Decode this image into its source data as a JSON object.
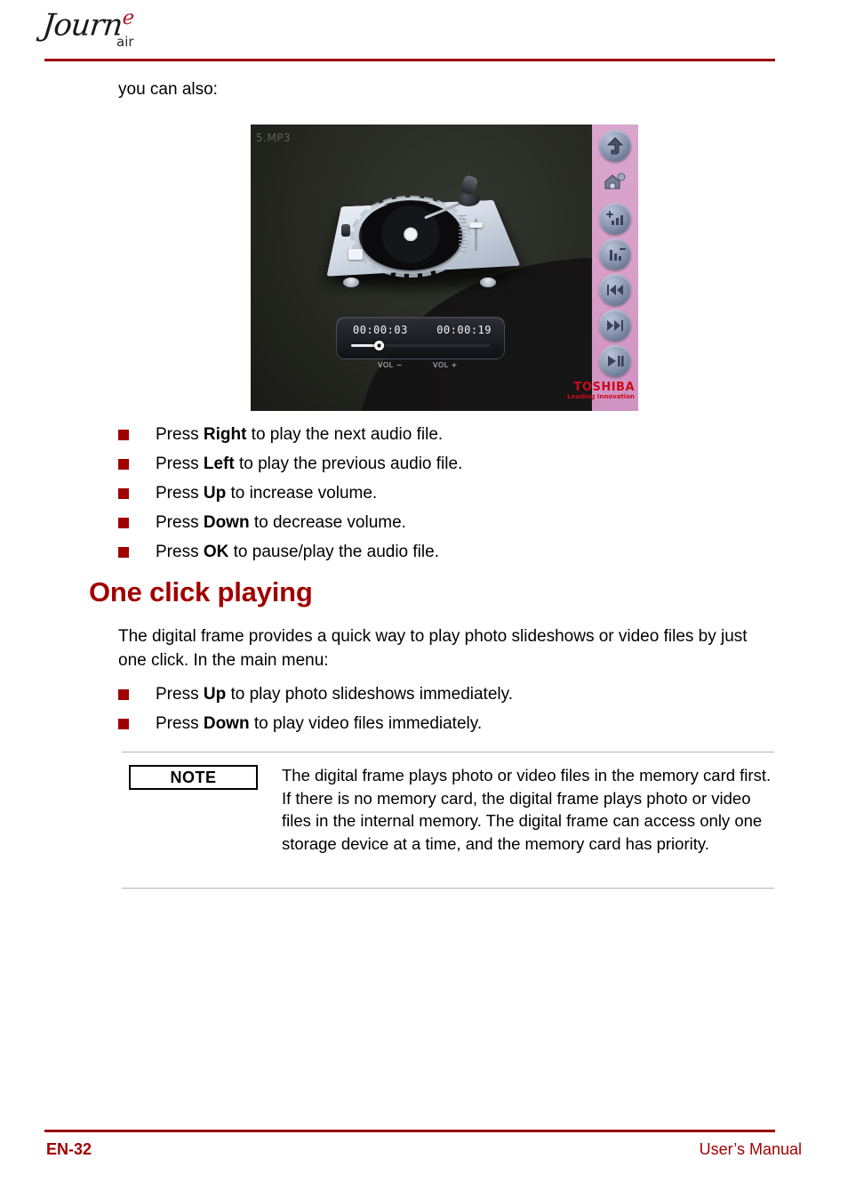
{
  "header": {
    "logo_word": "Journ",
    "logo_accent_letter": "e",
    "logo_sub": "air",
    "rule_color": "#9b0000"
  },
  "content": {
    "intro_line": "you can also:",
    "section_heading": "One click playing",
    "intro_paragraph": "The digital frame provides a quick way to play photo slideshows or video files by just one click. In the main menu:"
  },
  "device_photo": {
    "filename_overlay": "5.MP3",
    "time_elapsed": "00:00:03",
    "time_total": "00:00:19",
    "vol_down_label": "VOL −",
    "vol_up_label": "VOL +",
    "brand_wordmark": "TOSHIBA",
    "brand_tagline": "Leading Innovation",
    "rail_icons": [
      {
        "name": "back-up-arrow-icon",
        "glyph": "⬆"
      },
      {
        "name": "home-icon",
        "glyph": "⌂"
      },
      {
        "name": "volume-up-icon",
        "glyph": "▄"
      },
      {
        "name": "volume-down-icon",
        "glyph": "▃"
      },
      {
        "name": "previous-track-icon",
        "glyph": "⏮"
      },
      {
        "name": "next-track-icon",
        "glyph": "⏭"
      },
      {
        "name": "play-pause-icon",
        "glyph": "⏯"
      }
    ]
  },
  "bullets_audio": [
    {
      "prefix": "Press ",
      "key": "Right",
      "suffix": " to play the next audio file."
    },
    {
      "prefix": "Press ",
      "key": "Left",
      "suffix": " to play the previous audio file."
    },
    {
      "prefix": "Press ",
      "key": "Up",
      "suffix": " to increase volume."
    },
    {
      "prefix": "Press ",
      "key": "Down",
      "suffix": " to decrease volume."
    },
    {
      "prefix": "Press ",
      "key": "OK",
      "suffix": " to pause/play the audio file."
    }
  ],
  "bullets_oneclick": [
    {
      "prefix": "Press ",
      "key": "Up",
      "suffix": " to play photo slideshows immediately."
    },
    {
      "prefix": "Press ",
      "key": "Down",
      "suffix": " to play video files immediately."
    }
  ],
  "note": {
    "badge_label": "NOTE",
    "text": "The digital frame plays photo or video files in the memory card first. If there is no memory card, the digital frame plays photo or video files in the internal memory. The digital frame can access only one storage device at a time, and the memory card has priority."
  },
  "footer": {
    "page_number": "EN-32",
    "manual_label": "User’s Manual",
    "color": "#a00000"
  }
}
